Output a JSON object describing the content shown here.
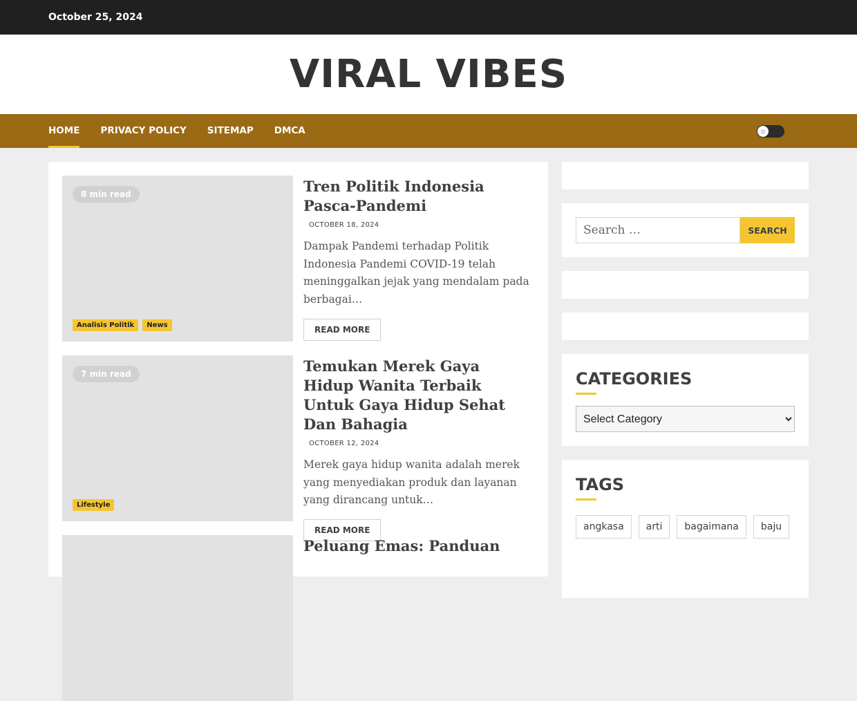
{
  "topbar": {
    "date": "October 25, 2024"
  },
  "site": {
    "title": "VIRAL VIBES"
  },
  "nav": {
    "items": [
      {
        "label": "HOME"
      },
      {
        "label": "PRIVACY POLICY"
      },
      {
        "label": "SITEMAP"
      },
      {
        "label": "DMCA"
      }
    ],
    "mode_toggle_icon": "sun-icon"
  },
  "posts": [
    {
      "read_time": "8 min read",
      "categories": [
        "Analisis Politik",
        "News"
      ],
      "title": "Tren Politik Indonesia Pasca-Pandemi",
      "date": "OCTOBER 18, 2024",
      "excerpt": "Dampak Pandemi terhadap Politik Indonesia Pandemi COVID-19 telah meninggalkan jejak yang mendalam pada berbagai…",
      "read_more": "READ MORE"
    },
    {
      "read_time": "7 min read",
      "categories": [
        "Lifestyle"
      ],
      "title": "Temukan Merek Gaya Hidup Wanita Terbaik Untuk Gaya Hidup Sehat Dan Bahagia",
      "date": "OCTOBER 12, 2024",
      "excerpt": "Merek gaya hidup wanita adalah merek yang menyediakan produk dan layanan yang dirancang untuk…",
      "read_more": "READ MORE"
    },
    {
      "title": "Peluang Emas: Panduan"
    }
  ],
  "sidebar": {
    "search": {
      "placeholder": "Search …",
      "button": "SEARCH"
    },
    "categories": {
      "title": "CATEGORIES",
      "selected": "Select Category"
    },
    "tags": {
      "title": "TAGS",
      "items": [
        "angkasa",
        "arti",
        "bagaimana",
        "baju"
      ]
    }
  },
  "colors": {
    "nav_bg": "#9b6a15",
    "accent": "#f5c531",
    "topbar_bg": "#202020"
  }
}
